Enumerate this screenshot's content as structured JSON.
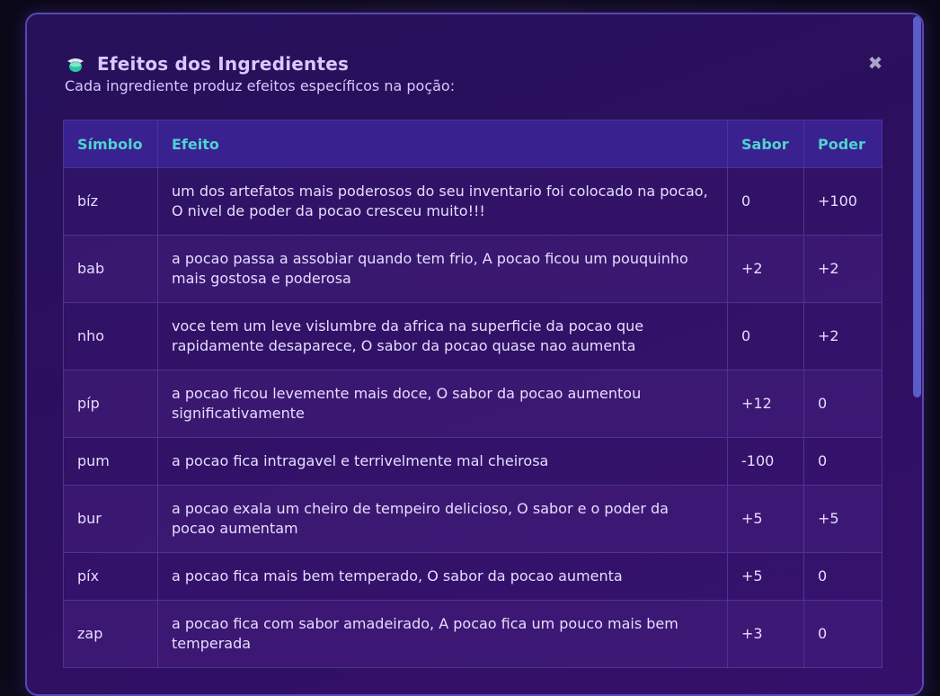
{
  "modal": {
    "title": "Efeitos dos Ingredientes",
    "subtitle": "Cada ingrediente produz efeitos específicos na poção:",
    "close_label": "✖"
  },
  "icons": {
    "title_icon": "potion-icon",
    "close_icon": "close-icon"
  },
  "colors": {
    "header_text": "#4fd3d0",
    "title_text": "#d9c8ff",
    "border": "#5a48b0"
  },
  "table": {
    "headers": [
      "Símbolo",
      "Efeito",
      "Sabor",
      "Poder"
    ],
    "rows": [
      {
        "simbolo": "bíz",
        "efeito": "um dos artefatos mais poderosos do seu inventario foi colocado na pocao, O nivel de poder da pocao cresceu muito!!!",
        "sabor": "0",
        "poder": "+100"
      },
      {
        "simbolo": "bab",
        "efeito": "a pocao passa a assobiar quando tem frio, A pocao ficou um pouquinho mais gostosa e poderosa",
        "sabor": "+2",
        "poder": "+2"
      },
      {
        "simbolo": "nho",
        "efeito": "voce tem um leve vislumbre da africa na superficie da pocao que rapidamente desaparece, O sabor da pocao quase nao aumenta",
        "sabor": "0",
        "poder": "+2"
      },
      {
        "simbolo": "píp",
        "efeito": "a pocao ficou levemente mais doce, O sabor da pocao aumentou significativamente",
        "sabor": "+12",
        "poder": "0"
      },
      {
        "simbolo": "pum",
        "efeito": "a pocao fica intragavel e terrivelmente mal cheirosa",
        "sabor": "-100",
        "poder": "0"
      },
      {
        "simbolo": "bur",
        "efeito": "a pocao exala um cheiro de tempeiro delicioso, O sabor e o poder da pocao aumentam",
        "sabor": "+5",
        "poder": "+5"
      },
      {
        "simbolo": "píx",
        "efeito": "a pocao fica mais bem temperado, O sabor da pocao aumenta",
        "sabor": "+5",
        "poder": "0"
      },
      {
        "simbolo": "zap",
        "efeito": "a pocao fica com sabor amadeirado, A pocao fica um pouco mais bem temperada",
        "sabor": "+3",
        "poder": "0"
      }
    ]
  }
}
